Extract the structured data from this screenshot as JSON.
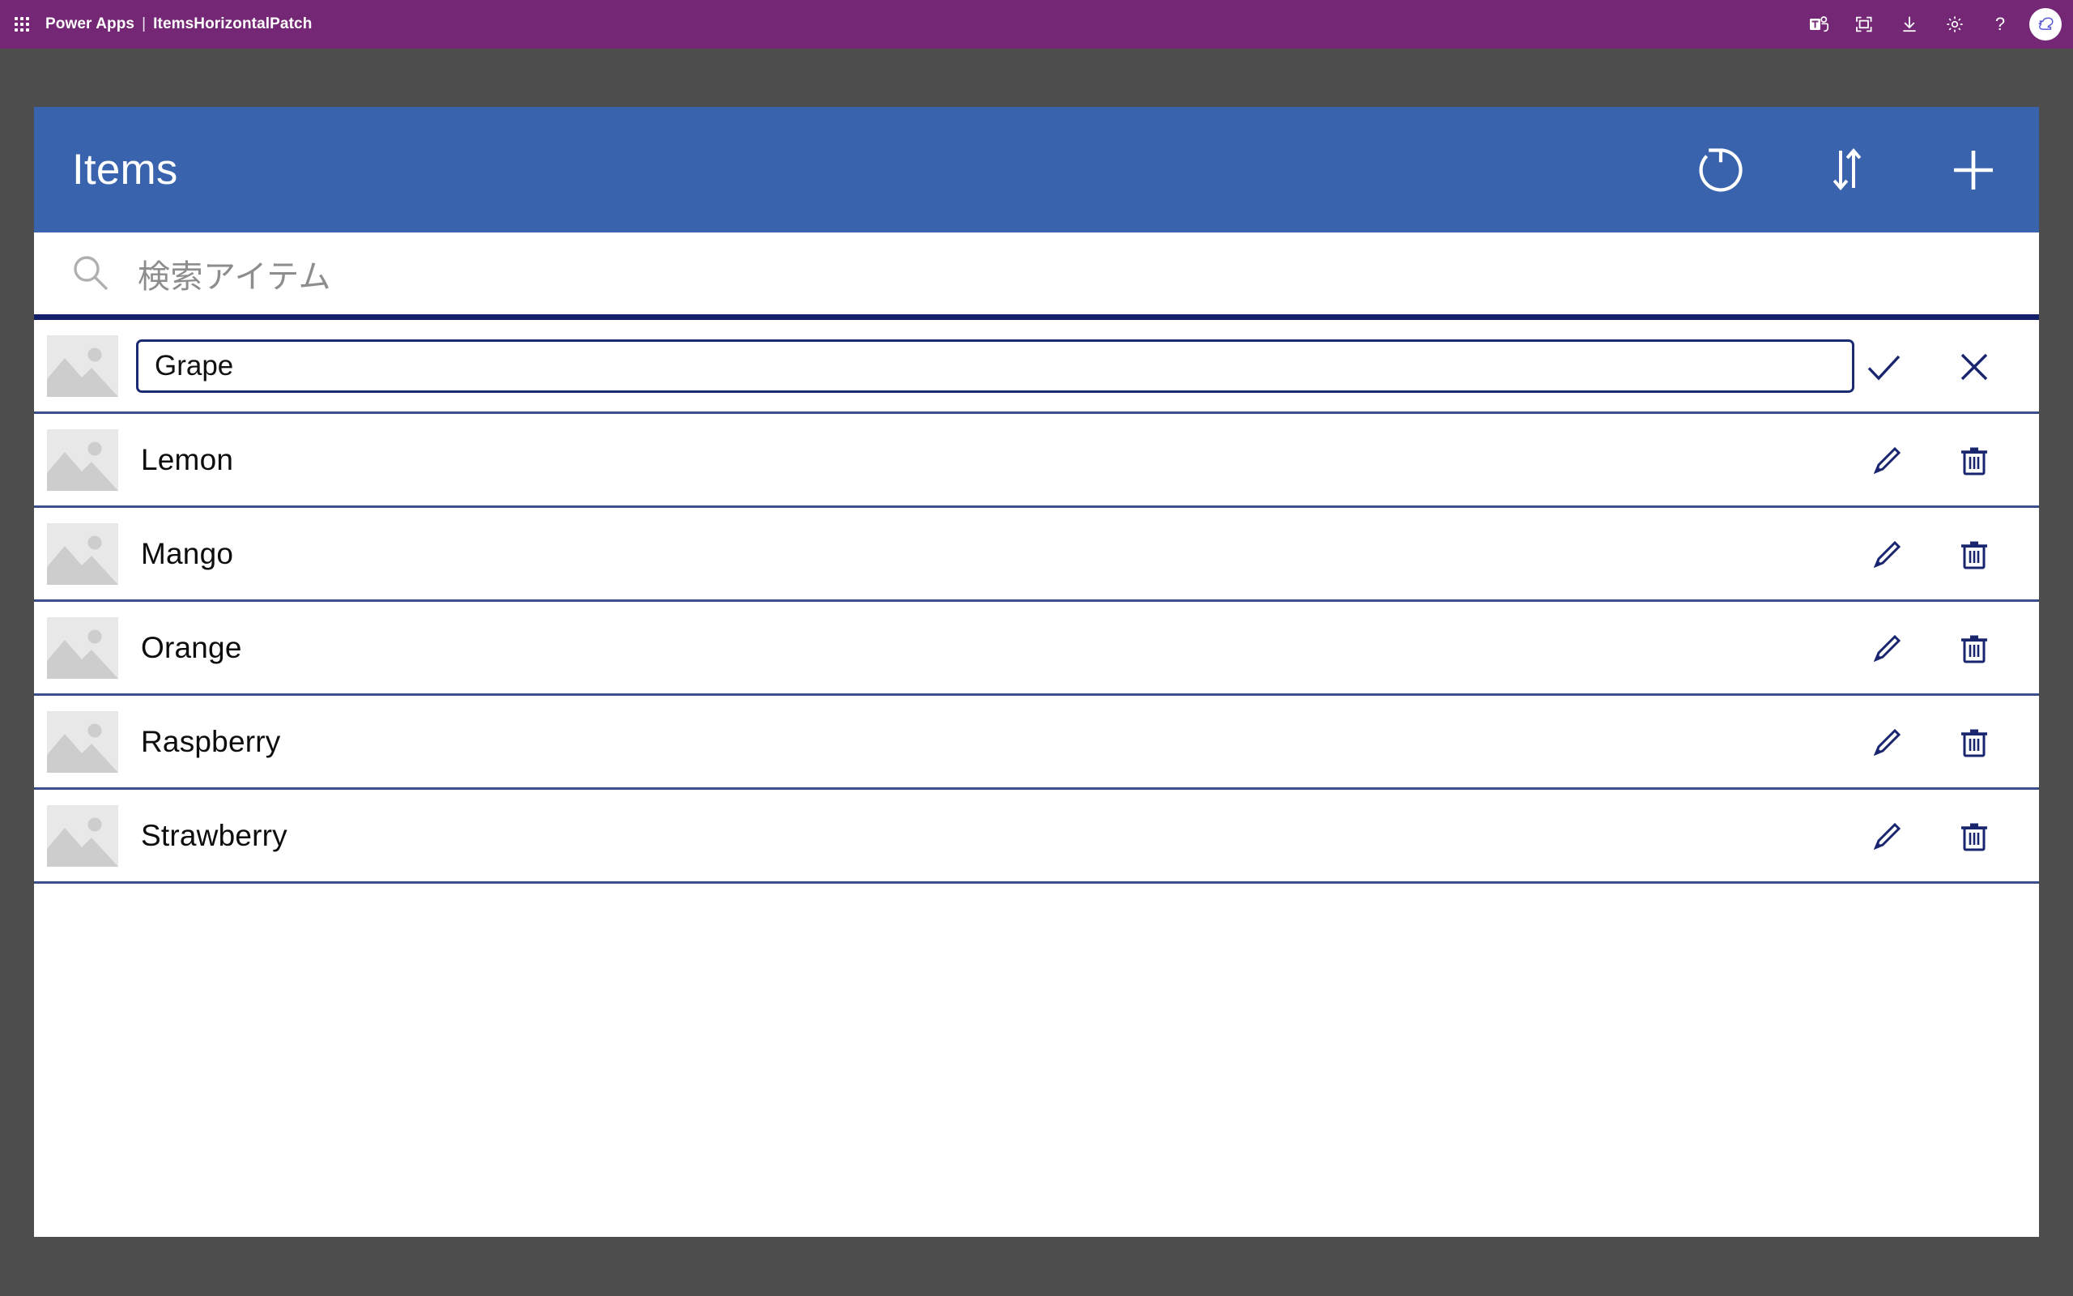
{
  "topbar": {
    "waffle_label": "app-launcher",
    "product": "Power Apps",
    "separator": "|",
    "app_name": "ItemsHorizontalPatch",
    "icons": [
      {
        "name": "teams-icon",
        "label": "Teams"
      },
      {
        "name": "fullscreen-icon",
        "label": "Full screen"
      },
      {
        "name": "download-icon",
        "label": "Download"
      },
      {
        "name": "gear-icon",
        "label": "Settings"
      },
      {
        "name": "help-icon",
        "label": "?"
      }
    ],
    "avatar": {
      "name": "user-avatar",
      "label": "Account"
    }
  },
  "app": {
    "title": "Items",
    "header_actions": [
      {
        "name": "refresh-icon",
        "label": "Refresh"
      },
      {
        "name": "sort-icon",
        "label": "Sort"
      },
      {
        "name": "add-icon",
        "label": "Add"
      }
    ],
    "search": {
      "icon": "search-icon",
      "placeholder": "検索アイテム",
      "value": ""
    },
    "rows": [
      {
        "label": "Grape",
        "editing": true,
        "input_value": "Grape",
        "actions": [
          {
            "name": "confirm-icon",
            "label": "Save"
          },
          {
            "name": "cancel-icon",
            "label": "Cancel"
          }
        ]
      },
      {
        "label": "Lemon",
        "editing": false,
        "actions": [
          {
            "name": "edit-icon",
            "label": "Edit"
          },
          {
            "name": "delete-icon",
            "label": "Delete"
          }
        ]
      },
      {
        "label": "Mango",
        "editing": false,
        "actions": [
          {
            "name": "edit-icon",
            "label": "Edit"
          },
          {
            "name": "delete-icon",
            "label": "Delete"
          }
        ]
      },
      {
        "label": "Orange",
        "editing": false,
        "actions": [
          {
            "name": "edit-icon",
            "label": "Edit"
          },
          {
            "name": "delete-icon",
            "label": "Delete"
          }
        ]
      },
      {
        "label": "Raspberry",
        "editing": false,
        "actions": [
          {
            "name": "edit-icon",
            "label": "Edit"
          },
          {
            "name": "delete-icon",
            "label": "Delete"
          }
        ]
      },
      {
        "label": "Strawberry",
        "editing": false,
        "actions": [
          {
            "name": "edit-icon",
            "label": "Edit"
          },
          {
            "name": "delete-icon",
            "label": "Delete"
          }
        ]
      }
    ]
  },
  "colors": {
    "brand_purple": "#742774",
    "app_header_blue": "#3a63ad",
    "accent_navy": "#141f6b",
    "row_divider": "#3e4f8e",
    "canvas_backdrop": "#4d4d4d",
    "placeholder_gray": "#8d8d8d",
    "thumb_bg": "#e8e8e8",
    "thumb_fg": "#cdcdcd"
  }
}
